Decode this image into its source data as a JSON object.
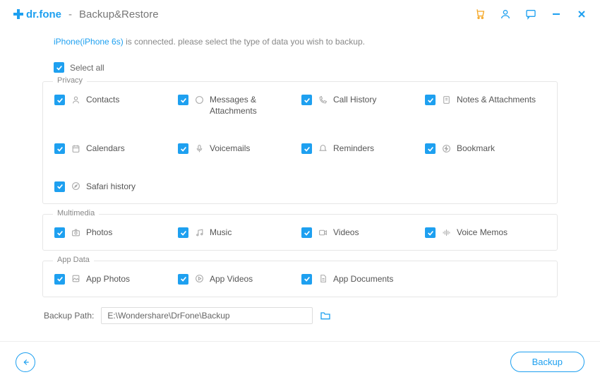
{
  "header": {
    "brand": "dr.fone",
    "separator": "-",
    "title": "Backup&Restore"
  },
  "connection": {
    "device": "iPhone(iPhone 6s)",
    "message": " is connected. please select the type of data you wish to backup."
  },
  "select_all_label": "Select all",
  "sections": {
    "privacy": {
      "legend": "Privacy"
    },
    "multimedia": {
      "legend": "Multimedia"
    },
    "appdata": {
      "legend": "App Data"
    }
  },
  "items": {
    "contacts": "Contacts",
    "messages": "Messages & Attachments",
    "callhistory": "Call History",
    "notes": "Notes & Attachments",
    "calendars": "Calendars",
    "voicemails": "Voicemails",
    "reminders": "Reminders",
    "bookmark": "Bookmark",
    "safari": "Safari history",
    "photos": "Photos",
    "music": "Music",
    "videos": "Videos",
    "voicememos": "Voice Memos",
    "appphotos": "App Photos",
    "appvideos": "App Videos",
    "appdocs": "App Documents"
  },
  "path": {
    "label": "Backup Path:",
    "value": "E:\\Wondershare\\DrFone\\Backup"
  },
  "footer": {
    "backup": "Backup"
  }
}
